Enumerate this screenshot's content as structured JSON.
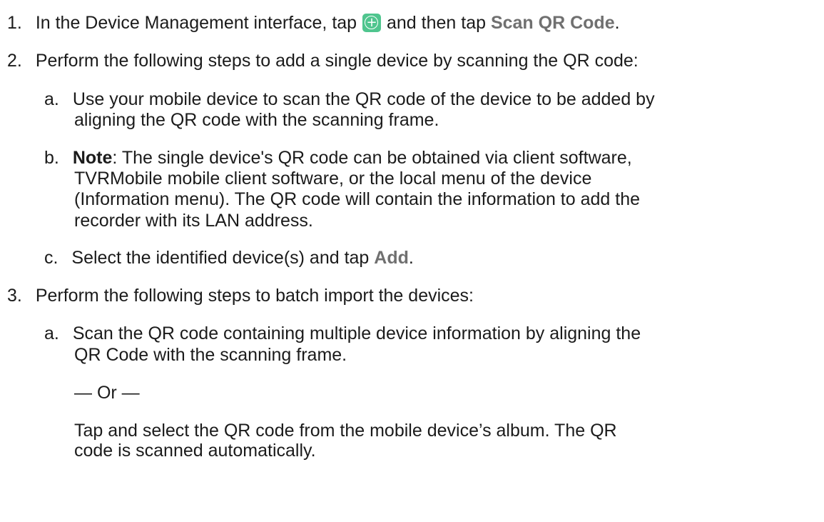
{
  "steps": [
    {
      "number": "1.",
      "text_before": "In the Device Management interface, tap",
      "icon": "add-circle-icon",
      "text_middle": "and then tap",
      "link": "Scan QR Code",
      "text_after": "."
    },
    {
      "number": "2.",
      "text": "Perform the following steps to add a single device by scanning the QR code:",
      "substeps": [
        {
          "letter": "a.",
          "lines": [
            "Use your mobile device to scan the QR code of the device to be added by",
            "aligning the QR code with the scanning frame."
          ]
        },
        {
          "letter": "b.",
          "note_label": "Note",
          "first_line_rest": ": The single device's QR code can be obtained via client software,",
          "lines": [
            "TVRMobile mobile client software, or the local menu of the device",
            "(Information menu). The QR code will contain the information to add the",
            "recorder with its LAN address."
          ]
        },
        {
          "letter": "c.",
          "text_before": "Select the identified device(s) and tap",
          "link": "Add",
          "text_after": "."
        }
      ]
    },
    {
      "number": "3.",
      "text": "Perform the following steps to batch import the devices:",
      "substeps": [
        {
          "letter": "a.",
          "lines": [
            "Scan the QR code containing multiple device information by aligning the",
            "QR Code with the scanning frame."
          ],
          "or_text": "— Or —",
          "alt_lines": [
            "Tap and select the QR code from the mobile device’s album. The QR",
            "code is scanned automatically."
          ]
        }
      ]
    }
  ],
  "colors": {
    "text": "#1b1b1b",
    "ui_term": "#707070",
    "icon_green": "#4fc58e"
  }
}
